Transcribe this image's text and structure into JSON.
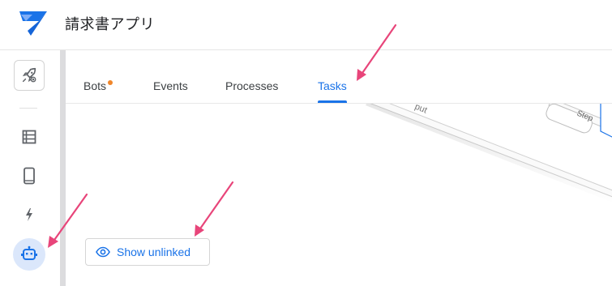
{
  "app": {
    "title": "請求書アプリ"
  },
  "colors": {
    "accent": "#1a73e8",
    "badge_dot": "#f0862a",
    "annotation_arrow": "#e8457a",
    "logo": "#1a73e8"
  },
  "sidebar": {
    "items": [
      {
        "icon": "rocket-icon",
        "selected": false
      },
      {
        "icon": "data-table-icon",
        "selected": false
      },
      {
        "icon": "mobile-phone-icon",
        "selected": false
      },
      {
        "icon": "lightning-icon",
        "selected": false
      },
      {
        "icon": "robot-icon",
        "selected": true
      }
    ]
  },
  "tabs": [
    {
      "label": "Bots",
      "has_dot": true
    },
    {
      "label": "Events"
    },
    {
      "label": "Processes"
    },
    {
      "label": "Tasks",
      "active": true
    }
  ],
  "canvas": {
    "partial_labels": [
      "put",
      "Step"
    ]
  },
  "actions": {
    "show_unlinked_label": "Show unlinked",
    "show_unlinked_icon": "eye-icon"
  },
  "annotations": {
    "arrow_count": 3
  }
}
